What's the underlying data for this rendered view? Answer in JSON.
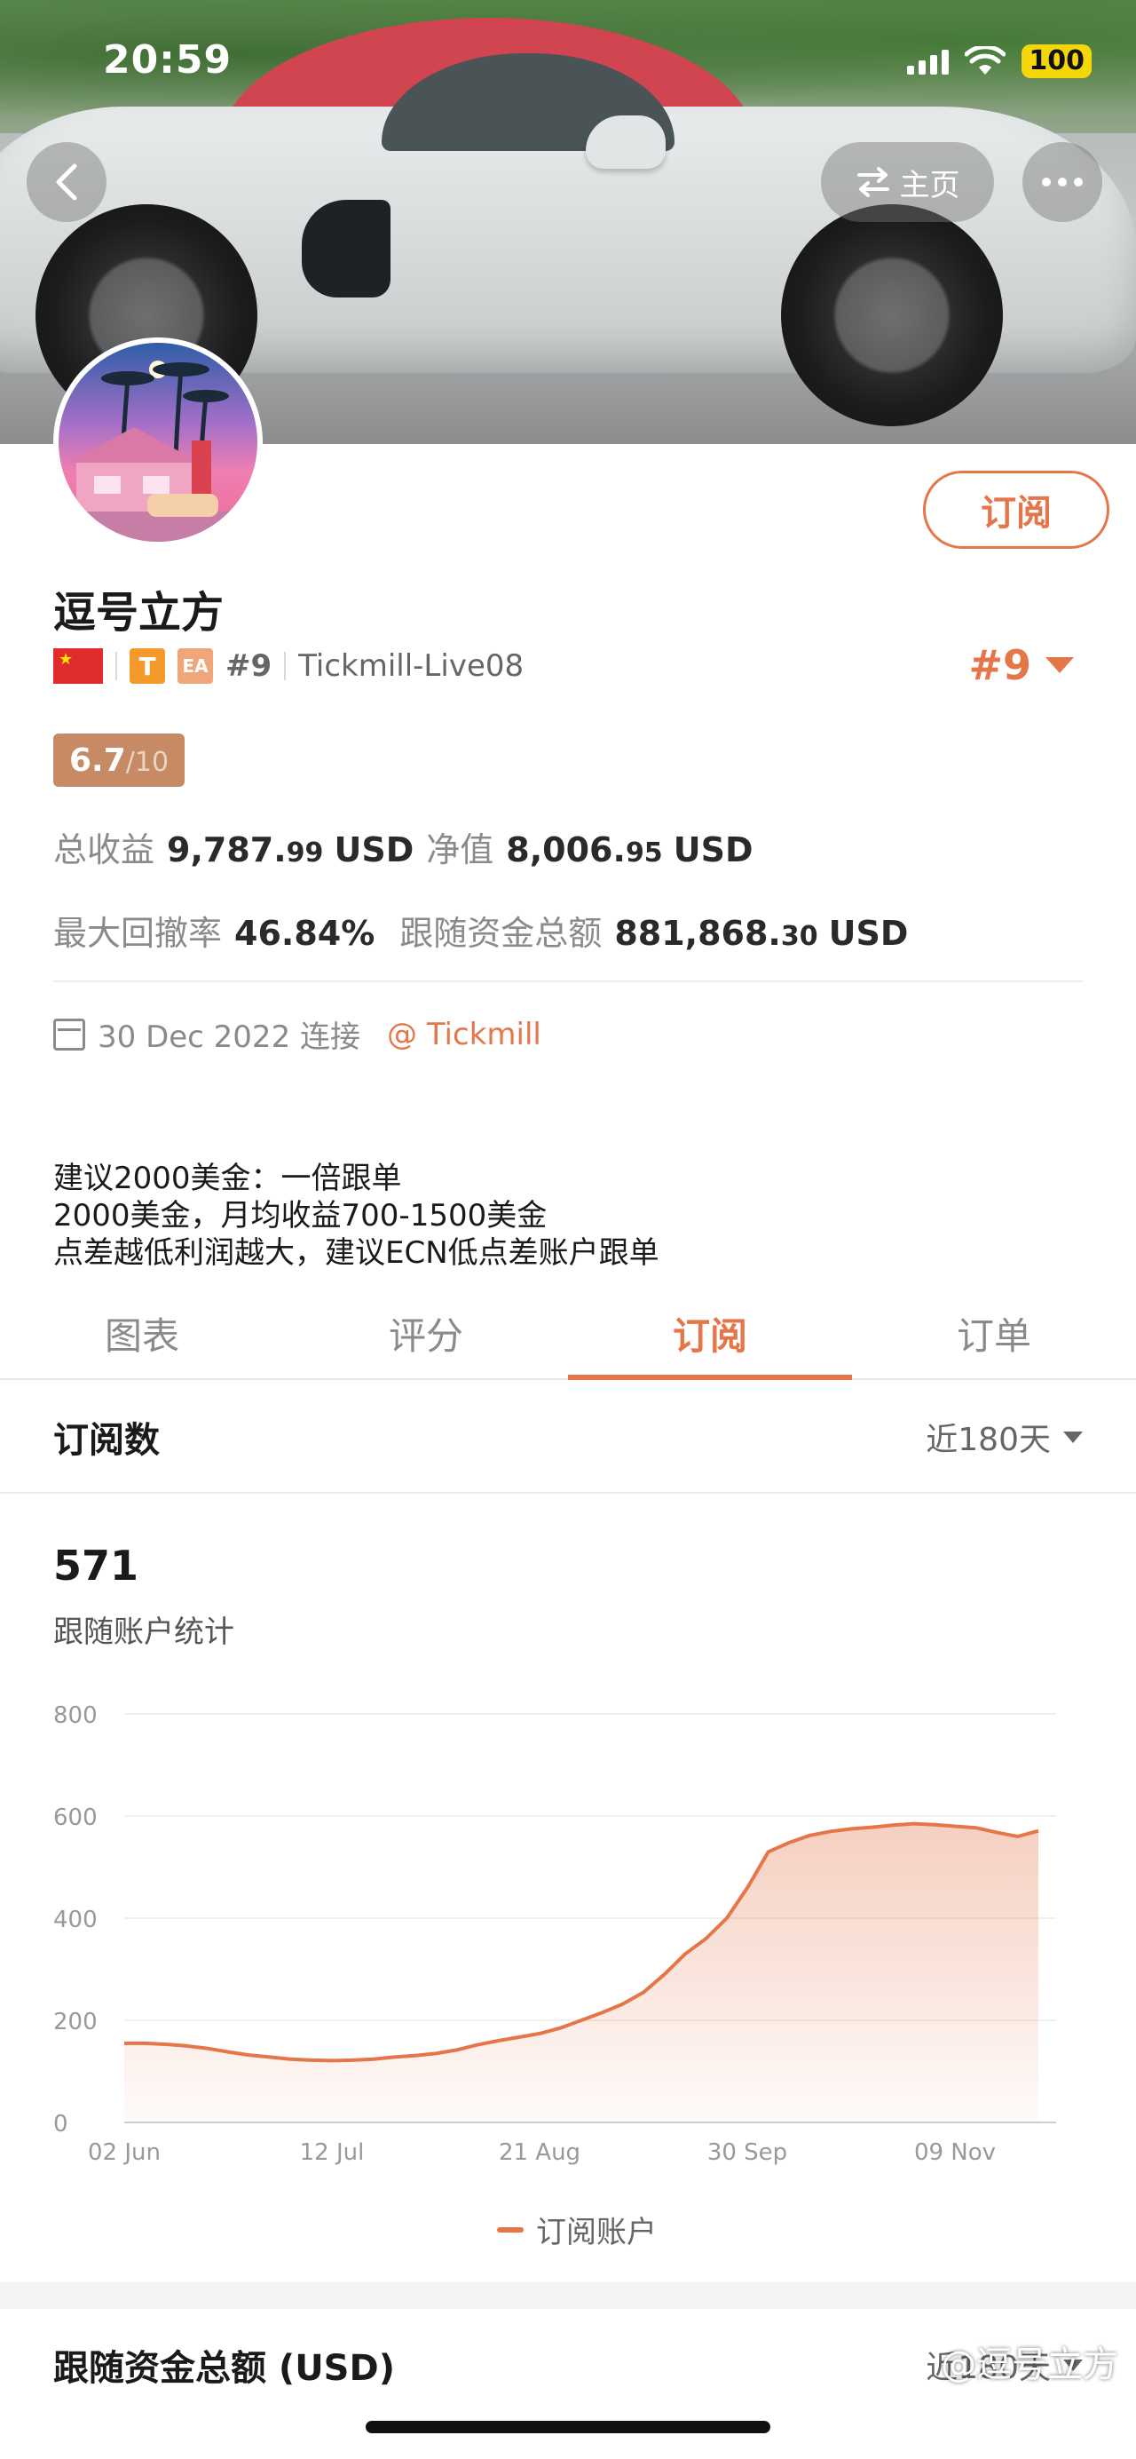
{
  "status": {
    "time": "20:59",
    "battery": "100"
  },
  "nav": {
    "home_label": "主页"
  },
  "profile": {
    "name": "逗号立方",
    "tag_t": "T",
    "tag_ea": "EA",
    "rank_small": "#9",
    "server": "Tickmill-Live08",
    "rank_big": "#9",
    "subscribe_label": "订阅",
    "score_value": "6.7",
    "score_denominator": "/10"
  },
  "stats": {
    "total_profit_label": "总收益",
    "total_profit_main": "9,787.",
    "total_profit_cents": "99",
    "total_profit_unit": "USD",
    "equity_label": "净值",
    "equity_main": "8,006.",
    "equity_cents": "95",
    "equity_unit": "USD",
    "max_drawdown_label": "最大回撤率",
    "max_drawdown_value": "46.84%",
    "follow_funds_label": "跟随资金总额",
    "follow_funds_main": "881,868.",
    "follow_funds_cents": "30",
    "follow_funds_unit": "USD"
  },
  "connect": {
    "date": "30 Dec 2022 连接",
    "broker": "@ Tickmill"
  },
  "description": [
    "建议2000美金：一倍跟单",
    "2000美金，月均收益700-1500美金",
    "点差越低利润越大，建议ECN低点差账户跟单"
  ],
  "tabs": [
    {
      "label": "图表"
    },
    {
      "label": "评分"
    },
    {
      "label": "订阅"
    },
    {
      "label": "订单"
    }
  ],
  "subscriptions": {
    "title": "订阅数",
    "period": "近180天",
    "count": "571",
    "sub_label": "跟随账户统计",
    "legend": "订阅账户"
  },
  "funds_section": {
    "title": "跟随资金总额 (USD)",
    "period": "近180天"
  },
  "watermark": "@逗号立方",
  "colors": {
    "accent": "#e5764a",
    "score_bg": "#c68a64"
  },
  "chart_data": {
    "type": "area",
    "series": [
      {
        "name": "订阅账户",
        "values": [
          155,
          155,
          153,
          150,
          145,
          138,
          132,
          128,
          124,
          122,
          121,
          122,
          124,
          128,
          131,
          135,
          142,
          152,
          160,
          167,
          174,
          185,
          200,
          215,
          232,
          255,
          290,
          330,
          360,
          400,
          460,
          530,
          548,
          562,
          570,
          575,
          578,
          582,
          585,
          583,
          580,
          577,
          568,
          560,
          571
        ]
      }
    ],
    "x_tick_labels": [
      "02 Jun",
      "12 Jul",
      "21 Aug",
      "30 Sep",
      "09 Nov"
    ],
    "y_tick_labels": [
      "0",
      "200",
      "400",
      "600",
      "800"
    ],
    "ylim": [
      0,
      800
    ],
    "grid": true,
    "legend_position": "bottom-center"
  }
}
